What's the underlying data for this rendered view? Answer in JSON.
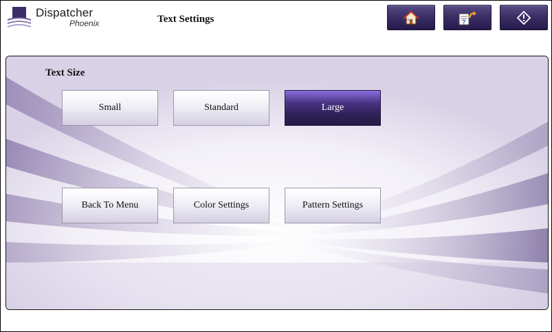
{
  "header": {
    "logo_name": "Dispatcher",
    "logo_sub": "Phoenix",
    "title": "Text Settings",
    "buttons": [
      {
        "icon": "home-icon"
      },
      {
        "icon": "job-status-icon"
      },
      {
        "icon": "logout-icon"
      }
    ]
  },
  "text_size": {
    "label": "Text Size",
    "options": [
      {
        "label": "Small",
        "selected": false
      },
      {
        "label": "Standard",
        "selected": false
      },
      {
        "label": "Large",
        "selected": true
      }
    ]
  },
  "nav": {
    "back": "Back To Menu",
    "color": "Color Settings",
    "pattern": "Pattern Settings"
  },
  "colors": {
    "accent": "#2e2156",
    "accent_light": "#8a6ee0"
  }
}
